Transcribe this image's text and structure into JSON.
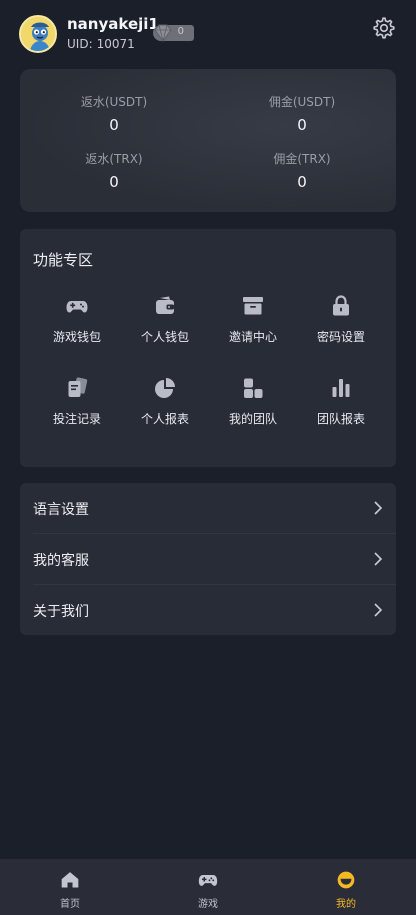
{
  "user": {
    "username": "nanyakeji1",
    "uid_label": "UID:",
    "uid_value": "10071",
    "vip_level": "0"
  },
  "stats": [
    {
      "label": "返水(USDT)",
      "value": "0"
    },
    {
      "label": "佣金(USDT)",
      "value": "0"
    },
    {
      "label": "返水(TRX)",
      "value": "0"
    },
    {
      "label": "佣金(TRX)",
      "value": "0"
    }
  ],
  "features": {
    "title": "功能专区",
    "items": [
      {
        "label": "游戏钱包",
        "icon": "gamepad-icon"
      },
      {
        "label": "个人钱包",
        "icon": "wallet-icon"
      },
      {
        "label": "邀请中心",
        "icon": "archive-box-icon"
      },
      {
        "label": "密码设置",
        "icon": "lock-icon"
      },
      {
        "label": "投注记录",
        "icon": "cards-icon"
      },
      {
        "label": "个人报表",
        "icon": "pie-chart-icon"
      },
      {
        "label": "我的团队",
        "icon": "team-icon"
      },
      {
        "label": "团队报表",
        "icon": "bar-chart-icon"
      }
    ]
  },
  "menu": [
    {
      "label": "语言设置"
    },
    {
      "label": "我的客服"
    },
    {
      "label": "关于我们"
    }
  ],
  "nav": [
    {
      "label": "首页",
      "icon": "home-icon"
    },
    {
      "label": "游戏",
      "icon": "gamepad-icon"
    },
    {
      "label": "我的",
      "icon": "smile-icon",
      "active": true
    }
  ],
  "colors": {
    "background": "#1b1f2a",
    "card": "#282c37",
    "accent": "#f5b825",
    "icon": "#b9bcc6"
  }
}
